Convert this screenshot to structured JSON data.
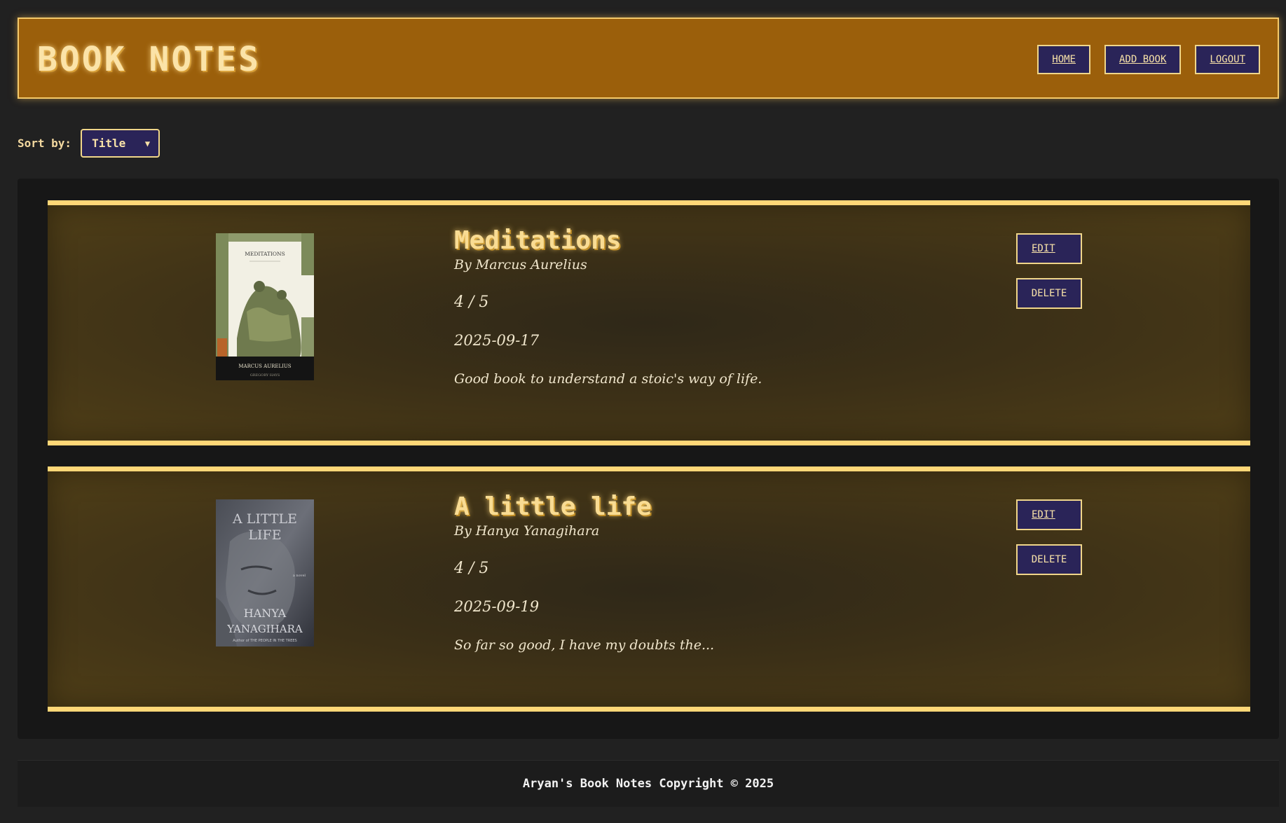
{
  "header": {
    "logo": "BOOK NOTES",
    "nav": [
      {
        "label": "HOME"
      },
      {
        "label": "ADD BOOK"
      },
      {
        "label": "LOGOUT"
      }
    ]
  },
  "sort": {
    "label": "Sort by:",
    "selected": "Title",
    "arrow": "▼"
  },
  "books": [
    {
      "title": "Meditations",
      "author": "By Marcus Aurelius",
      "rating": "4 / 5",
      "date": "2025-09-17",
      "notes": "Good book to understand a stoic's way of life.",
      "cover": {
        "title_text": "MEDITATIONS",
        "author_text": "MARCUS AURELIUS",
        "translator_text": "GREGORY HAYS"
      },
      "edit_label": "EDIT",
      "delete_label": "DELETE"
    },
    {
      "title": "A little life",
      "author": "By Hanya Yanagihara",
      "rating": "4 / 5",
      "date": "2025-09-19",
      "notes": "So far so good, I have my doubts the...",
      "cover": {
        "title_line1": "A LITTLE",
        "title_line2": "LIFE",
        "subtitle_text": "a novel",
        "author_line1": "HANYA",
        "author_line2": "YANAGIHARA",
        "tagline_text": "Author of THE PEOPLE IN THE TREES"
      },
      "edit_label": "EDIT",
      "delete_label": "DELETE"
    }
  ],
  "footer": {
    "text": "Aryan's Book Notes Copyright © 2025"
  },
  "colors": {
    "header_bg": "#9b5f0b",
    "accent_gold": "#ffd777",
    "button_bg": "#2a2458",
    "page_bg": "#212121"
  }
}
